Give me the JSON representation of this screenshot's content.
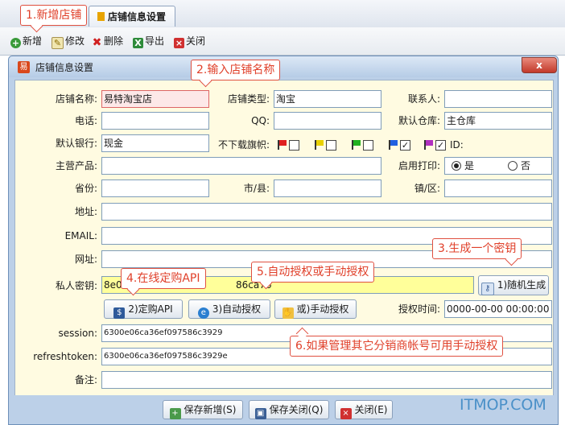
{
  "app": {
    "tab_title": "店铺信息设置"
  },
  "toolbar": {
    "add": "新增",
    "edit": "修改",
    "delete": "删除",
    "export": "导出",
    "close": "关闭"
  },
  "dialog": {
    "title": "店铺信息设置",
    "close_glyph": "x",
    "icon_glyph": "易"
  },
  "form": {
    "store_name": {
      "label": "店铺名称:",
      "value": "易特淘宝店"
    },
    "store_type": {
      "label": "店铺类型:",
      "value": "淘宝"
    },
    "contact": {
      "label": "联系人:",
      "value": ""
    },
    "phone": {
      "label": "电话:",
      "value": ""
    },
    "qq": {
      "label": "QQ:",
      "value": ""
    },
    "warehouse": {
      "label": "默认仓库:",
      "value": "主仓库"
    },
    "bank": {
      "label": "默认银行:",
      "value": "现金"
    },
    "flags": {
      "label": "不下载旗帜:",
      "id_label": "ID:",
      "checks": [
        false,
        false,
        false,
        true,
        true
      ]
    },
    "product": {
      "label": "主营产品:",
      "value": ""
    },
    "print": {
      "label": "启用打印:",
      "yes": "是",
      "no": "否",
      "selected": "yes"
    },
    "province": {
      "label": "省份:",
      "value": ""
    },
    "city": {
      "label": "市/县:",
      "value": ""
    },
    "town": {
      "label": "镇/区:",
      "value": ""
    },
    "address": {
      "label": "地址:",
      "value": ""
    },
    "email": {
      "label": "EMAIL:",
      "value": ""
    },
    "website": {
      "label": "网址:",
      "value": ""
    },
    "private_key": {
      "label": "私人密钥:",
      "value_left": "8e0ac",
      "value_right": "86ca76"
    },
    "random_btn": "1)随机生成",
    "order_api_btn": "2)定购API",
    "auto_auth_btn": "3)自动授权",
    "manual_auth_btn": "或)手动授权",
    "auth_time": {
      "label": "授权时间:",
      "value": "0000-00-00 00:00:00"
    },
    "session": {
      "label": "session:",
      "value": "6300e06ca36ef097586c3929"
    },
    "refresh": {
      "label": "refreshtoken:",
      "value": "6300e06ca36ef097586c3929e"
    },
    "note": {
      "label": "备注:",
      "value": ""
    }
  },
  "footer": {
    "save_new": "保存新增(S)",
    "save_close": "保存关闭(Q)",
    "close": "关闭(E)"
  },
  "callouts": {
    "c1": "1.新增店铺",
    "c2": "2.输入店铺名称",
    "c3": "3.生成一个密钥",
    "c4": "4.在线定购API",
    "c5": "5.自动授权或手动授权",
    "c6": "6.如果管理其它分销商帐号可用手动授权"
  },
  "watermark": "ITMOP.COM",
  "colors": {
    "accent_red": "#e05040",
    "form_bg": "#fffbe1",
    "dialog_bg": "#bcd0e8",
    "watermark": "#4a90c8"
  }
}
